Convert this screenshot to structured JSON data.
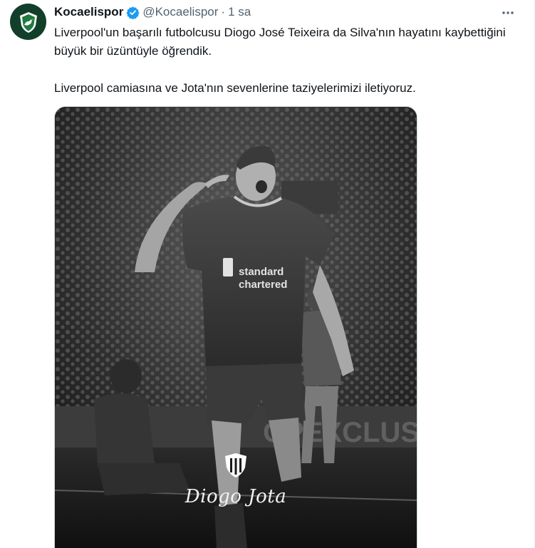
{
  "author": {
    "display_name": "Kocaelispor",
    "handle": "@Kocaelispor",
    "separator": "·",
    "time": "1 sa",
    "avatar_icon": "kocaelispor-crest-icon",
    "verified_icon": "verified-badge-icon",
    "avatar_color": "#123f2a",
    "verified_color": "#1d9bf0"
  },
  "tweet": {
    "paragraph_1": "Liverpool'un başarılı futbolcusu Diogo José Teixeira da Silva'nın hayatını kaybettiğini büyük bir üzüntüyle öğrendik.",
    "paragraph_2": "Liverpool camiasına ve Jota'nın sevenlerine taziyelerimizi iletiyoruz."
  },
  "media": {
    "caption": "Diogo Jota",
    "crest_icon": "kocaelispor-crest-icon"
  },
  "more_icon": "more-options-icon"
}
